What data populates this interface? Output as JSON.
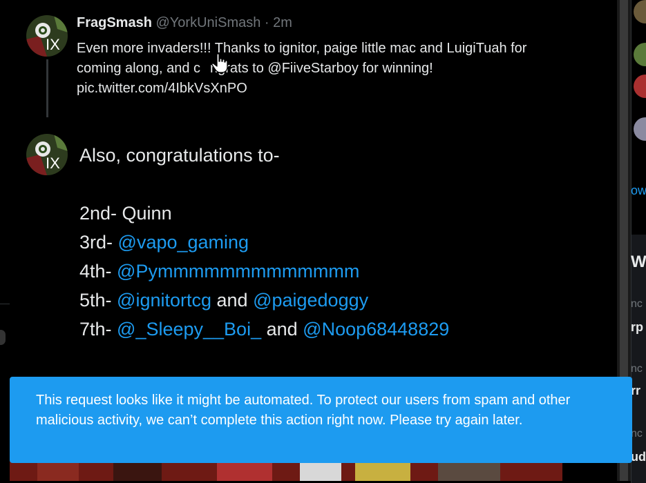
{
  "tweet1": {
    "display_name": "FragSmash",
    "handle": "@YorkUniSmash",
    "separator": " · ",
    "time": "2m",
    "text_line1": "Even more invaders!!! Thanks to ignitor, paige little mac and LuigiTuah for",
    "text_line2a": "coming along, and c",
    "text_line2b": "ngrats to ",
    "text_mention": "@FiiveStarboy",
    "text_line2c": " for winning!",
    "text_line3": "pic.twitter.com/4IbkVsXnPO"
  },
  "tweet2": {
    "line1": "Also, congratulations to-",
    "line2_prefix": "2nd- Quinn",
    "line3_prefix": "3rd- ",
    "line3_mention": "@vapo_gaming",
    "line4_prefix": "4th- ",
    "line4_mention": "@Pymmmmmmmmmmmmm",
    "line5_prefix": "5th- ",
    "line5_mention_a": "@ignitortcg",
    "line5_and": " and ",
    "line5_mention_b": "@paigedoggy",
    "line6_prefix": "7th- ",
    "line6_mention_a": "@_Sleepy__Boi_",
    "line6_and": " and ",
    "line6_mention_b": "@Noop68448829"
  },
  "toast": {
    "message": "This request looks like it might be automated. To protect our users from spam and other malicious activity, we can’t complete this action right now. Please try again later."
  },
  "sidebar_fragments": {
    "frag_ow": "ow",
    "frag_wh": "Wh",
    "frag_nc1": "nc",
    "frag_rp": "rp",
    "frag_nc2": "nc",
    "frag_rr": "rr",
    "frag_nc3": "nc",
    "frag_ud": "ud"
  },
  "colors": {
    "accent": "#1d9bf0",
    "background": "#000000",
    "toast_bg": "#1d9bf0",
    "muted": "#71767b"
  },
  "icons": {
    "avatar": "fragsmash-avatar",
    "cursor": "hand-pointer-cursor"
  }
}
